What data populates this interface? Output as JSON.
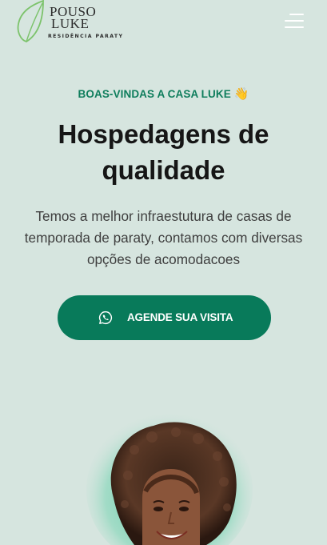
{
  "header": {
    "logo": {
      "line1": "POUSO",
      "line2": "LUKE",
      "subtitle": "RESIDÊNCIA PARATY"
    },
    "menu_icon": "hamburger-menu-icon"
  },
  "hero": {
    "eyebrow": "BOAS-VINDAS A CASA LUKE",
    "eyebrow_emoji": "👋",
    "title": "Hospedagens de qualidade",
    "description": "Temos a melhor infraestutura de casas de temporada de paraty, contamos com diversas opções de acomodacoes",
    "cta": {
      "label": "AGENDE SUA VISITA",
      "icon": "whatsapp-icon"
    }
  },
  "colors": {
    "background": "#d6e5df",
    "accent": "#087a5a",
    "eyebrow": "#0e7d5c",
    "leaf": "#7cc36b"
  }
}
